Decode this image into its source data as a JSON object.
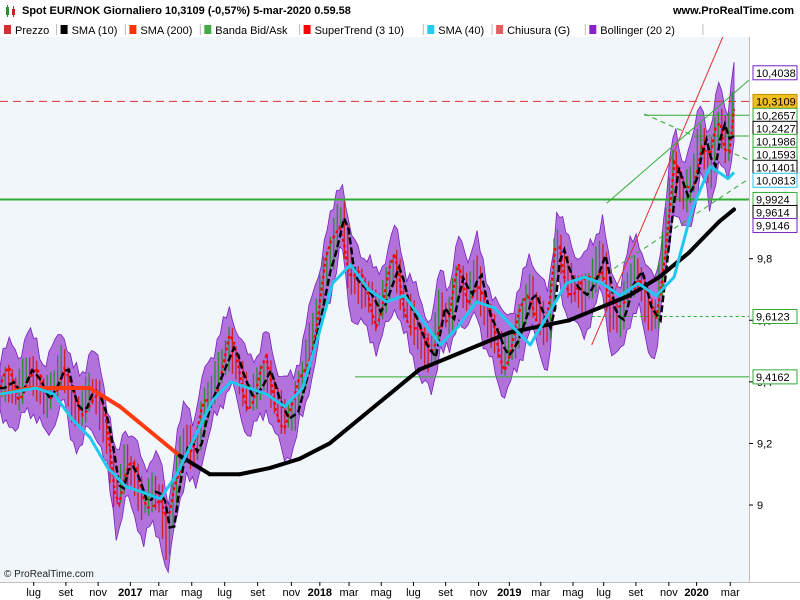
{
  "header": {
    "title": "Spot EUR/NOK Giornaliero 10,3109 (-0,57%) 5-mar-2020 0.59.58",
    "site": "www.ProRealTime.com"
  },
  "legend": [
    {
      "label": "Prezzo",
      "color": "#cc3333"
    },
    {
      "label": "SMA (10)",
      "color": "#000000"
    },
    {
      "label": "SMA (200)",
      "color": "#ff3300"
    },
    {
      "label": "Banda Bid/Ask",
      "color": "#44aa44"
    },
    {
      "label": "SuperTrend (3 10)",
      "color": "#ff0000"
    },
    {
      "label": "SMA (40)",
      "color": "#22ccee"
    },
    {
      "label": "Chiusura (G)",
      "color": "#e06060"
    },
    {
      "label": "Bollinger (20 2)",
      "color": "#8822cc"
    }
  ],
  "copyright": "© ProRealTime.com",
  "colors": {
    "price_up": "#2e8b2e",
    "price_down": "#cc2222",
    "sma10": "#000000",
    "sma200_below": "#ff3a10",
    "sma200_above": "#000000",
    "sma40": "#20c8f0",
    "supertrend": "#ff0000",
    "bollinger_fill": "#9a3fd0",
    "bollinger_line": "#7a20c0",
    "close_line": "#e03030",
    "support_line": "#33aa33",
    "plot_background": "#f1f6fb"
  },
  "chart_data": {
    "type": "line",
    "title": "Spot EUR/NOK Giornaliero 10,3109 (-0,57%) 5-mar-2020 0.59.58",
    "xlabel": "",
    "ylabel": "",
    "ylim": [
      8.75,
      10.52
    ],
    "grid": false,
    "legend_position": "top",
    "y_ticks": [
      9,
      9.2,
      9.4,
      9.6,
      9.8
    ],
    "x_ticks": [
      {
        "label": "lug",
        "t": 0.045,
        "bold": false
      },
      {
        "label": "set",
        "t": 0.088,
        "bold": false
      },
      {
        "label": "nov",
        "t": 0.131,
        "bold": false
      },
      {
        "label": "2017",
        "t": 0.174,
        "bold": true
      },
      {
        "label": "mar",
        "t": 0.212,
        "bold": false
      },
      {
        "label": "mag",
        "t": 0.256,
        "bold": false
      },
      {
        "label": "lug",
        "t": 0.3,
        "bold": false
      },
      {
        "label": "set",
        "t": 0.344,
        "bold": false
      },
      {
        "label": "nov",
        "t": 0.389,
        "bold": false
      },
      {
        "label": "2018",
        "t": 0.427,
        "bold": true
      },
      {
        "label": "mar",
        "t": 0.466,
        "bold": false
      },
      {
        "label": "mag",
        "t": 0.509,
        "bold": false
      },
      {
        "label": "lug",
        "t": 0.552,
        "bold": false
      },
      {
        "label": "set",
        "t": 0.595,
        "bold": false
      },
      {
        "label": "nov",
        "t": 0.639,
        "bold": false
      },
      {
        "label": "2019",
        "t": 0.68,
        "bold": true
      },
      {
        "label": "mar",
        "t": 0.722,
        "bold": false
      },
      {
        "label": "mag",
        "t": 0.765,
        "bold": false
      },
      {
        "label": "lug",
        "t": 0.806,
        "bold": false
      },
      {
        "label": "set",
        "t": 0.849,
        "bold": false
      },
      {
        "label": "nov",
        "t": 0.893,
        "bold": false
      },
      {
        "label": "2020",
        "t": 0.93,
        "bold": true
      },
      {
        "label": "mar",
        "t": 0.975,
        "bold": false
      }
    ],
    "price_tags": [
      {
        "label": "10,4038",
        "value": 10.4038,
        "bg": "#ffffff",
        "border": "#7a20c0",
        "color": "#000000"
      },
      {
        "label": "10,3109",
        "value": 10.3109,
        "bg": "#f0c020",
        "border": "#c09000",
        "color": "#000000"
      },
      {
        "label": "10,2657",
        "value": 10.2657,
        "bg": "#ffffff",
        "border": "#33aa33",
        "color": "#000000"
      },
      {
        "label": "10,2427",
        "value": 10.2427,
        "bg": "#ffffff",
        "border": "#000000",
        "color": "#000000"
      },
      {
        "label": "10,1986",
        "value": 10.1986,
        "bg": "#ffffff",
        "border": "#33aa33",
        "color": "#000000"
      },
      {
        "label": "10,1593",
        "value": 10.1593,
        "bg": "#ffffff",
        "border": "#33aa33",
        "color": "#000000"
      },
      {
        "label": "10,1401",
        "value": 10.1401,
        "bg": "#ffffff",
        "border": "#000000",
        "color": "#000000"
      },
      {
        "label": "10,0813",
        "value": 10.0813,
        "bg": "#ffffff",
        "border": "#20c8f0",
        "color": "#1aa8d8"
      },
      {
        "label": "9,9924",
        "value": 9.9924,
        "bg": "#ffffff",
        "border": "#33aa33",
        "color": "#000000"
      },
      {
        "label": "9,9614",
        "value": 9.9614,
        "bg": "#ffffff",
        "border": "#000000",
        "color": "#000000"
      },
      {
        "label": "9,9146",
        "value": 9.9146,
        "bg": "#ffffff",
        "border": "#7a20c0",
        "color": "#7a20c0"
      },
      {
        "label": "9,6123",
        "value": 9.6123,
        "bg": "#ffffff",
        "border": "#33aa33",
        "color": "#000000"
      },
      {
        "label": "9,4162",
        "value": 9.4162,
        "bg": "#ffffff",
        "border": "#33aa33",
        "color": "#000000"
      }
    ],
    "horizontal_lines": [
      {
        "value": 10.3109,
        "style": "dashed",
        "color": "#e03030",
        "from_t": 0.0,
        "to_t": 1.0
      },
      {
        "value": 9.9924,
        "style": "solid",
        "color": "#33aa33",
        "from_t": 0.0,
        "to_t": 1.0
      },
      {
        "value": 9.4162,
        "style": "solid",
        "color": "#33aa33",
        "from_t": 0.474,
        "to_t": 1.0
      },
      {
        "value": 9.6123,
        "style": "dotted",
        "color": "#33aa33",
        "from_t": 0.79,
        "to_t": 1.0
      },
      {
        "value": 10.2657,
        "style": "solid",
        "color": "#33aa33",
        "from_t": 0.86,
        "to_t": 1.0
      },
      {
        "value": 10.1986,
        "style": "solid",
        "color": "#33aa33",
        "from_t": 0.93,
        "to_t": 1.0
      }
    ],
    "trend_lines": [
      {
        "from": [
          0.79,
          9.52
        ],
        "to": [
          1.0,
          10.72
        ],
        "color": "#e03030"
      },
      {
        "from": [
          0.81,
          9.98
        ],
        "to": [
          1.0,
          10.38
        ],
        "color": "#33aa33"
      },
      {
        "from": [
          0.79,
          9.72
        ],
        "to": [
          1.0,
          10.06
        ],
        "color": "#33aa33",
        "style": "dashed"
      },
      {
        "from": [
          0.86,
          10.27
        ],
        "to": [
          1.0,
          10.12
        ],
        "color": "#33aa33",
        "style": "dashed"
      }
    ],
    "series": [
      {
        "name": "Prezzo",
        "t": [
          0.0,
          0.012,
          0.024,
          0.036,
          0.048,
          0.06,
          0.072,
          0.084,
          0.096,
          0.108,
          0.12,
          0.132,
          0.144,
          0.156,
          0.168,
          0.18,
          0.192,
          0.204,
          0.214,
          0.224,
          0.236,
          0.248,
          0.26,
          0.272,
          0.284,
          0.296,
          0.308,
          0.32,
          0.332,
          0.344,
          0.356,
          0.368,
          0.38,
          0.392,
          0.404,
          0.414,
          0.424,
          0.434,
          0.444,
          0.456,
          0.468,
          0.48,
          0.492,
          0.504,
          0.516,
          0.528,
          0.54,
          0.552,
          0.564,
          0.576,
          0.588,
          0.6,
          0.612,
          0.624,
          0.636,
          0.648,
          0.66,
          0.672,
          0.684,
          0.696,
          0.708,
          0.72,
          0.732,
          0.744,
          0.756,
          0.768,
          0.78,
          0.792,
          0.804,
          0.816,
          0.828,
          0.84,
          0.852,
          0.864,
          0.876,
          0.888,
          0.9,
          0.912,
          0.924,
          0.936,
          0.948,
          0.96,
          0.972,
          0.98
        ],
        "values": [
          9.38,
          9.4,
          9.36,
          9.44,
          9.41,
          9.34,
          9.39,
          9.46,
          9.33,
          9.3,
          9.38,
          9.34,
          9.21,
          9.02,
          9.14,
          9.09,
          9.0,
          9.05,
          9.02,
          8.88,
          9.1,
          9.22,
          9.16,
          9.3,
          9.38,
          9.45,
          9.52,
          9.42,
          9.35,
          9.38,
          9.44,
          9.34,
          9.28,
          9.3,
          9.41,
          9.52,
          9.62,
          9.75,
          9.83,
          9.96,
          9.74,
          9.71,
          9.68,
          9.62,
          9.7,
          9.78,
          9.66,
          9.6,
          9.52,
          9.48,
          9.64,
          9.6,
          9.74,
          9.68,
          9.76,
          9.62,
          9.56,
          9.48,
          9.52,
          9.6,
          9.7,
          9.62,
          9.56,
          9.86,
          9.75,
          9.7,
          9.68,
          9.74,
          9.82,
          9.62,
          9.6,
          9.72,
          9.76,
          9.64,
          9.6,
          9.86,
          10.1,
          10.0,
          10.05,
          10.2,
          10.08,
          10.25,
          10.16,
          10.31
        ]
      },
      {
        "name": "SMA (40)",
        "t": [
          0.0,
          0.024,
          0.048,
          0.072,
          0.096,
          0.12,
          0.144,
          0.168,
          0.192,
          0.214,
          0.236,
          0.26,
          0.284,
          0.308,
          0.332,
          0.356,
          0.38,
          0.404,
          0.424,
          0.444,
          0.468,
          0.492,
          0.516,
          0.54,
          0.564,
          0.588,
          0.612,
          0.636,
          0.66,
          0.684,
          0.708,
          0.732,
          0.756,
          0.78,
          0.804,
          0.828,
          0.852,
          0.876,
          0.9,
          0.924,
          0.948,
          0.972,
          0.98
        ],
        "values": [
          9.36,
          9.37,
          9.38,
          9.36,
          9.28,
          9.22,
          9.12,
          9.06,
          9.04,
          9.02,
          9.1,
          9.22,
          9.34,
          9.4,
          9.38,
          9.36,
          9.32,
          9.38,
          9.54,
          9.72,
          9.78,
          9.7,
          9.66,
          9.68,
          9.6,
          9.52,
          9.58,
          9.66,
          9.64,
          9.58,
          9.52,
          9.62,
          9.72,
          9.74,
          9.72,
          9.68,
          9.72,
          9.68,
          9.74,
          9.96,
          10.1,
          10.06,
          10.08
        ]
      },
      {
        "name": "SMA (200)",
        "t": [
          0.0,
          0.04,
          0.08,
          0.12,
          0.16,
          0.2,
          0.24,
          0.28,
          0.32,
          0.36,
          0.4,
          0.44,
          0.48,
          0.52,
          0.56,
          0.6,
          0.64,
          0.68,
          0.72,
          0.76,
          0.8,
          0.84,
          0.88,
          0.92,
          0.96,
          0.98
        ],
        "values": [
          9.36,
          9.38,
          9.38,
          9.38,
          9.32,
          9.24,
          9.16,
          9.1,
          9.1,
          9.12,
          9.15,
          9.2,
          9.28,
          9.36,
          9.44,
          9.48,
          9.52,
          9.56,
          9.58,
          9.6,
          9.64,
          9.68,
          9.74,
          9.82,
          9.92,
          9.96
        ]
      }
    ]
  }
}
